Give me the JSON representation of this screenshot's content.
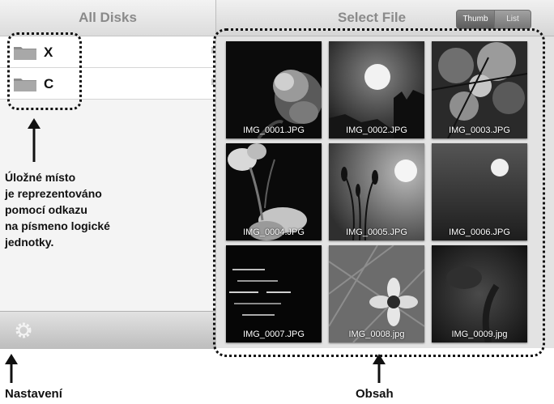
{
  "sidebar": {
    "title": "All Disks",
    "disks": [
      {
        "label": "X",
        "icon": "folder-icon"
      },
      {
        "label": "C",
        "icon": "folder-icon"
      }
    ],
    "settings_icon": "gear-icon"
  },
  "content": {
    "title": "Select File",
    "view_modes": {
      "thumb": "Thumb",
      "list": "List",
      "selected": "Thumb"
    },
    "files": [
      {
        "name": "IMG_0001.JPG"
      },
      {
        "name": "IMG_0002.JPG"
      },
      {
        "name": "IMG_0003.JPG"
      },
      {
        "name": "IMG_0004.JPG"
      },
      {
        "name": "IMG_0005.JPG"
      },
      {
        "name": "IMG_0006.JPG"
      },
      {
        "name": "IMG_0007.JPG"
      },
      {
        "name": "IMG_0008.jpg"
      },
      {
        "name": "IMG_0009.jpg"
      }
    ]
  },
  "annotations": {
    "storage": [
      "Úložné místo",
      "je reprezentováno",
      "pomocí odkazu",
      "na písmeno logické",
      "jednotky."
    ],
    "settings": "Nastavení",
    "content": "Obsah"
  },
  "colors": {
    "sidebar_background": "#f4f4f4",
    "header_text": "#8a8a8a",
    "content_background": "#e3e3e3",
    "annotation": "#111111"
  }
}
